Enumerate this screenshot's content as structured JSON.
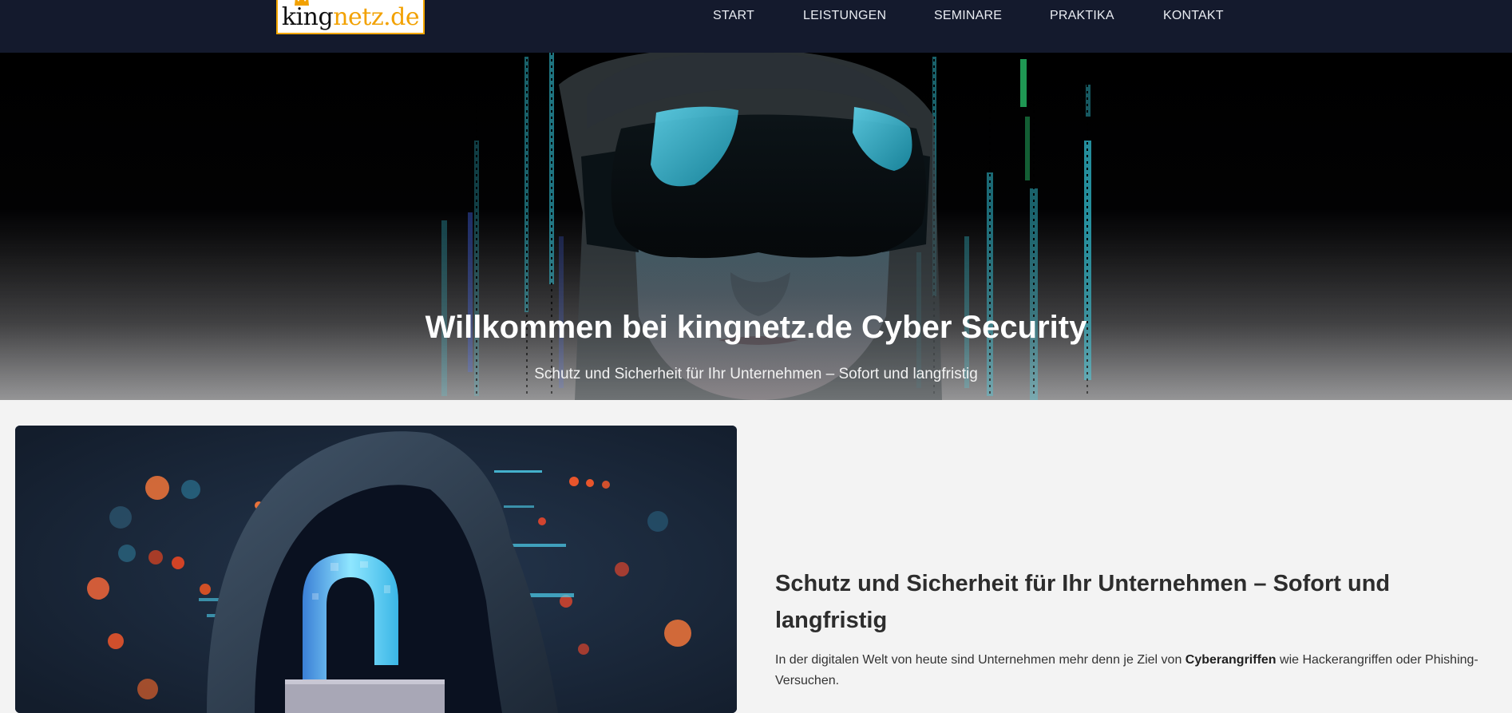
{
  "header": {
    "logo": {
      "text_part1": "king",
      "text_part2": "netz.de",
      "icon": "crown-icon"
    },
    "nav": [
      {
        "label": "START"
      },
      {
        "label": "LEISTUNGEN"
      },
      {
        "label": "SEMINARE"
      },
      {
        "label": "PRAKTIKA"
      },
      {
        "label": "KONTAKT"
      }
    ]
  },
  "hero": {
    "title": "Willkommen bei kingnetz.de Cyber Security",
    "subtitle": "Schutz und Sicherheit für Ihr Unternehmen – Sofort und langfristig"
  },
  "main": {
    "image": {
      "icon": "padlock-hooded-figure-image"
    },
    "heading": "Schutz und Sicherheit für Ihr Unternehmen – Sofort und langfristig",
    "paragraph": {
      "before": "In der digitalen Welt von heute sind Unternehmen mehr denn je Ziel von ",
      "bold": "Cyberangriffen",
      "after": " wie Hackerangriffen oder Phishing-Versuchen."
    }
  },
  "colors": {
    "header_bg": "#141a2d",
    "page_bg": "#f3f3f3",
    "logo_accent": "#f2a100",
    "text_dark": "#2d2d2d"
  }
}
